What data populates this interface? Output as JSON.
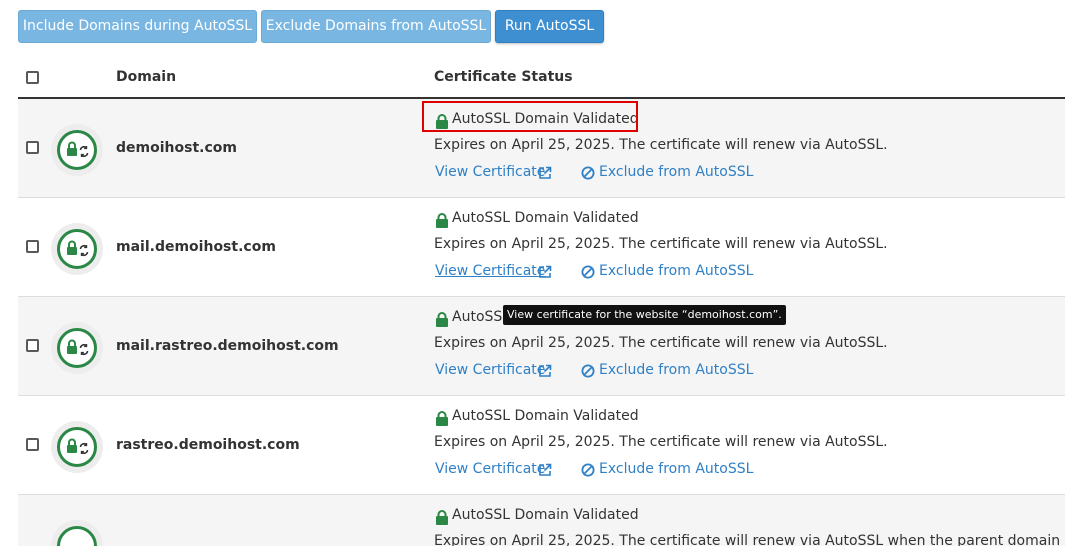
{
  "toolbar": {
    "include_label": "Include Domains during AutoSSL",
    "exclude_label": "Exclude Domains from AutoSSL",
    "run_label": "Run AutoSSL"
  },
  "table": {
    "col_domain": "Domain",
    "col_status": "Certificate Status"
  },
  "rows": [
    {
      "domain": "demoihost.com",
      "status": "AutoSSL Domain Validated",
      "expires": "Expires on April 25, 2025. The certificate will renew via AutoSSL.",
      "view_label": "View Certificate",
      "exclude_label": "Exclude from AutoSSL"
    },
    {
      "domain": "mail.demoihost.com",
      "status": "AutoSSL Domain Validated",
      "expires": "Expires on April 25, 2025. The certificate will renew via AutoSSL.",
      "view_label": "View Certificate",
      "exclude_label": "Exclude from AutoSSL"
    },
    {
      "domain": "mail.rastreo.demoihost.com",
      "status": "AutoSSL Domain Validated",
      "expires": "Expires on April 25, 2025. The certificate will renew via AutoSSL.",
      "view_label": "View Certificate",
      "exclude_label": "Exclude from AutoSSL"
    },
    {
      "domain": "rastreo.demoihost.com",
      "status": "AutoSSL Domain Validated",
      "expires": "Expires on April 25, 2025. The certificate will renew via AutoSSL.",
      "view_label": "View Certificate",
      "exclude_label": "Exclude from AutoSSL"
    },
    {
      "domain": "",
      "status": "AutoSSL Domain Validated",
      "expires": "Expires on April 25, 2025. The certificate will renew via AutoSSL when the parent domain"
    }
  ],
  "tooltip": "View certificate for the website “demoihost.com”.",
  "icons": {
    "status": "lock-sync-icon",
    "lock": "lock-icon",
    "external": "external-link-icon",
    "ban": "ban-icon"
  },
  "colors": {
    "button_light": "#79b6e2",
    "button_primary": "#3d8fd1",
    "link": "#2f80c6",
    "validated_green": "#2a8745",
    "highlight_red": "#e00000"
  }
}
